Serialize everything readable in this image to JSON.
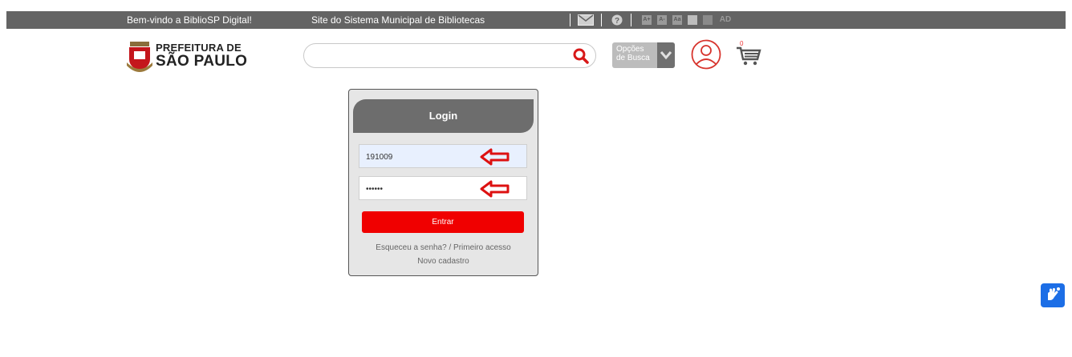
{
  "topbar": {
    "welcome": "Bem-vindo a BiblioSP Digital!",
    "site_link": "Site do Sistema Municipal de Bibliotecas",
    "icons": [
      "mail-icon",
      "help-icon",
      "font-increase",
      "font-decrease",
      "font-reset",
      "contrast",
      "contrast-off",
      "audio-description"
    ],
    "acc_labels": {
      "a_plus": "A+",
      "a_minus": "A-",
      "a_reset": "Aa",
      "ad": "AD"
    }
  },
  "header": {
    "logo_line1": "PREFEITURA DE",
    "logo_line2": "SÃO PAULO",
    "search": {
      "value": "",
      "placeholder": ""
    },
    "options_line1": "Opções",
    "options_line2": "de Busca",
    "cart_count": "0"
  },
  "login": {
    "title": "Login",
    "username_value": "191009",
    "password_value": "••••••",
    "submit_label": "Entrar",
    "forgot_link": "Esqueceu a senha? / Primeiro acesso",
    "register_link": "Novo cadastro"
  },
  "colors": {
    "topbar": "#646464",
    "accent_red": "#f00000",
    "login_header": "#6d6d6d",
    "vlibras": "#1c6ee6"
  }
}
